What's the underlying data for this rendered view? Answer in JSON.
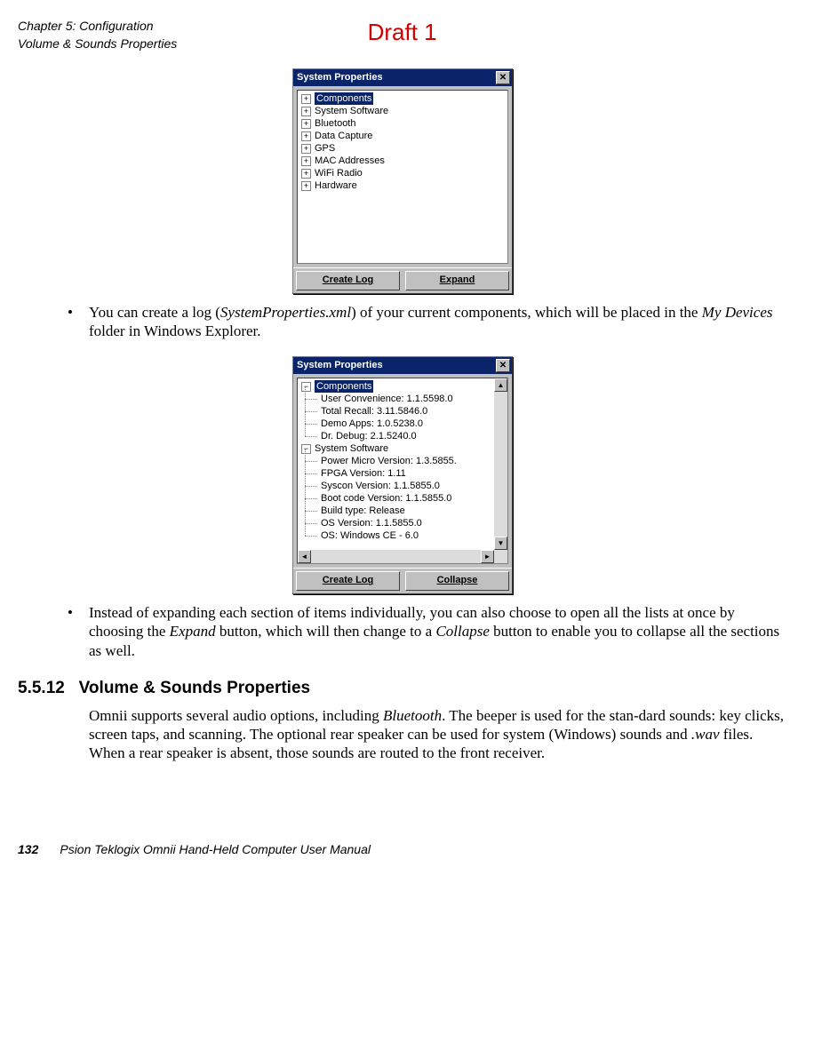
{
  "header": {
    "chapter": "Chapter 5: Configuration",
    "section": "Volume & Sounds Properties",
    "draft": "Draft 1"
  },
  "dialog1": {
    "title": "System Properties",
    "items": [
      "Components",
      "System Software",
      "Bluetooth",
      "Data Capture",
      "GPS",
      "MAC Addresses",
      "WiFi Radio",
      "Hardware"
    ],
    "btn_left": "Create Log",
    "btn_right": "Expand"
  },
  "para1": {
    "bullet": "•",
    "pre": "You can create a log (",
    "it1": "SystemProperties.xml",
    "mid1": ") of your current components, which will be placed in the ",
    "it2": "My Devices",
    "post": " folder in Windows Explorer."
  },
  "dialog2": {
    "title": "System Properties",
    "components_label": "Components",
    "comp_children": [
      "User Convenience: 1.1.5598.0",
      "Total Recall: 3.11.5846.0",
      "Demo Apps: 1.0.5238.0",
      "Dr. Debug: 2.1.5240.0"
    ],
    "sys_label": "System Software",
    "sys_children": [
      "Power Micro Version: 1.3.5855.",
      "FPGA Version: 1.11",
      "Syscon Version: 1.1.5855.0",
      "Boot code Version: 1.1.5855.0",
      "Build type: Release",
      "OS Version: 1.1.5855.0",
      "OS: Windows CE - 6.0"
    ],
    "btn_left": "Create Log",
    "btn_right": "Collapse"
  },
  "para2": {
    "bullet": "•",
    "pre": "Instead of expanding each section of items individually, you can also choose to open all the lists at once by choosing the ",
    "it1": "Expand",
    "mid": " button, which will then change to a ",
    "it2": "Collapse",
    "post": " button to enable you to collapse all the sections as well."
  },
  "heading": {
    "num": "5.5.12",
    "title": "Volume & Sounds Properties"
  },
  "para3": {
    "pre": "Omnii supports several audio options, including ",
    "it1": "Bluetooth",
    "mid": ". The beeper is used for the stan-dard sounds: key clicks, screen taps, and scanning. The optional rear speaker can be used for system (Windows) sounds and ",
    "it2": ".wav",
    "post": " files. When a rear speaker is absent, those sounds are routed to the front receiver."
  },
  "footer": {
    "page": "132",
    "text": "Psion Teklogix Omnii Hand-Held Computer User Manual"
  }
}
